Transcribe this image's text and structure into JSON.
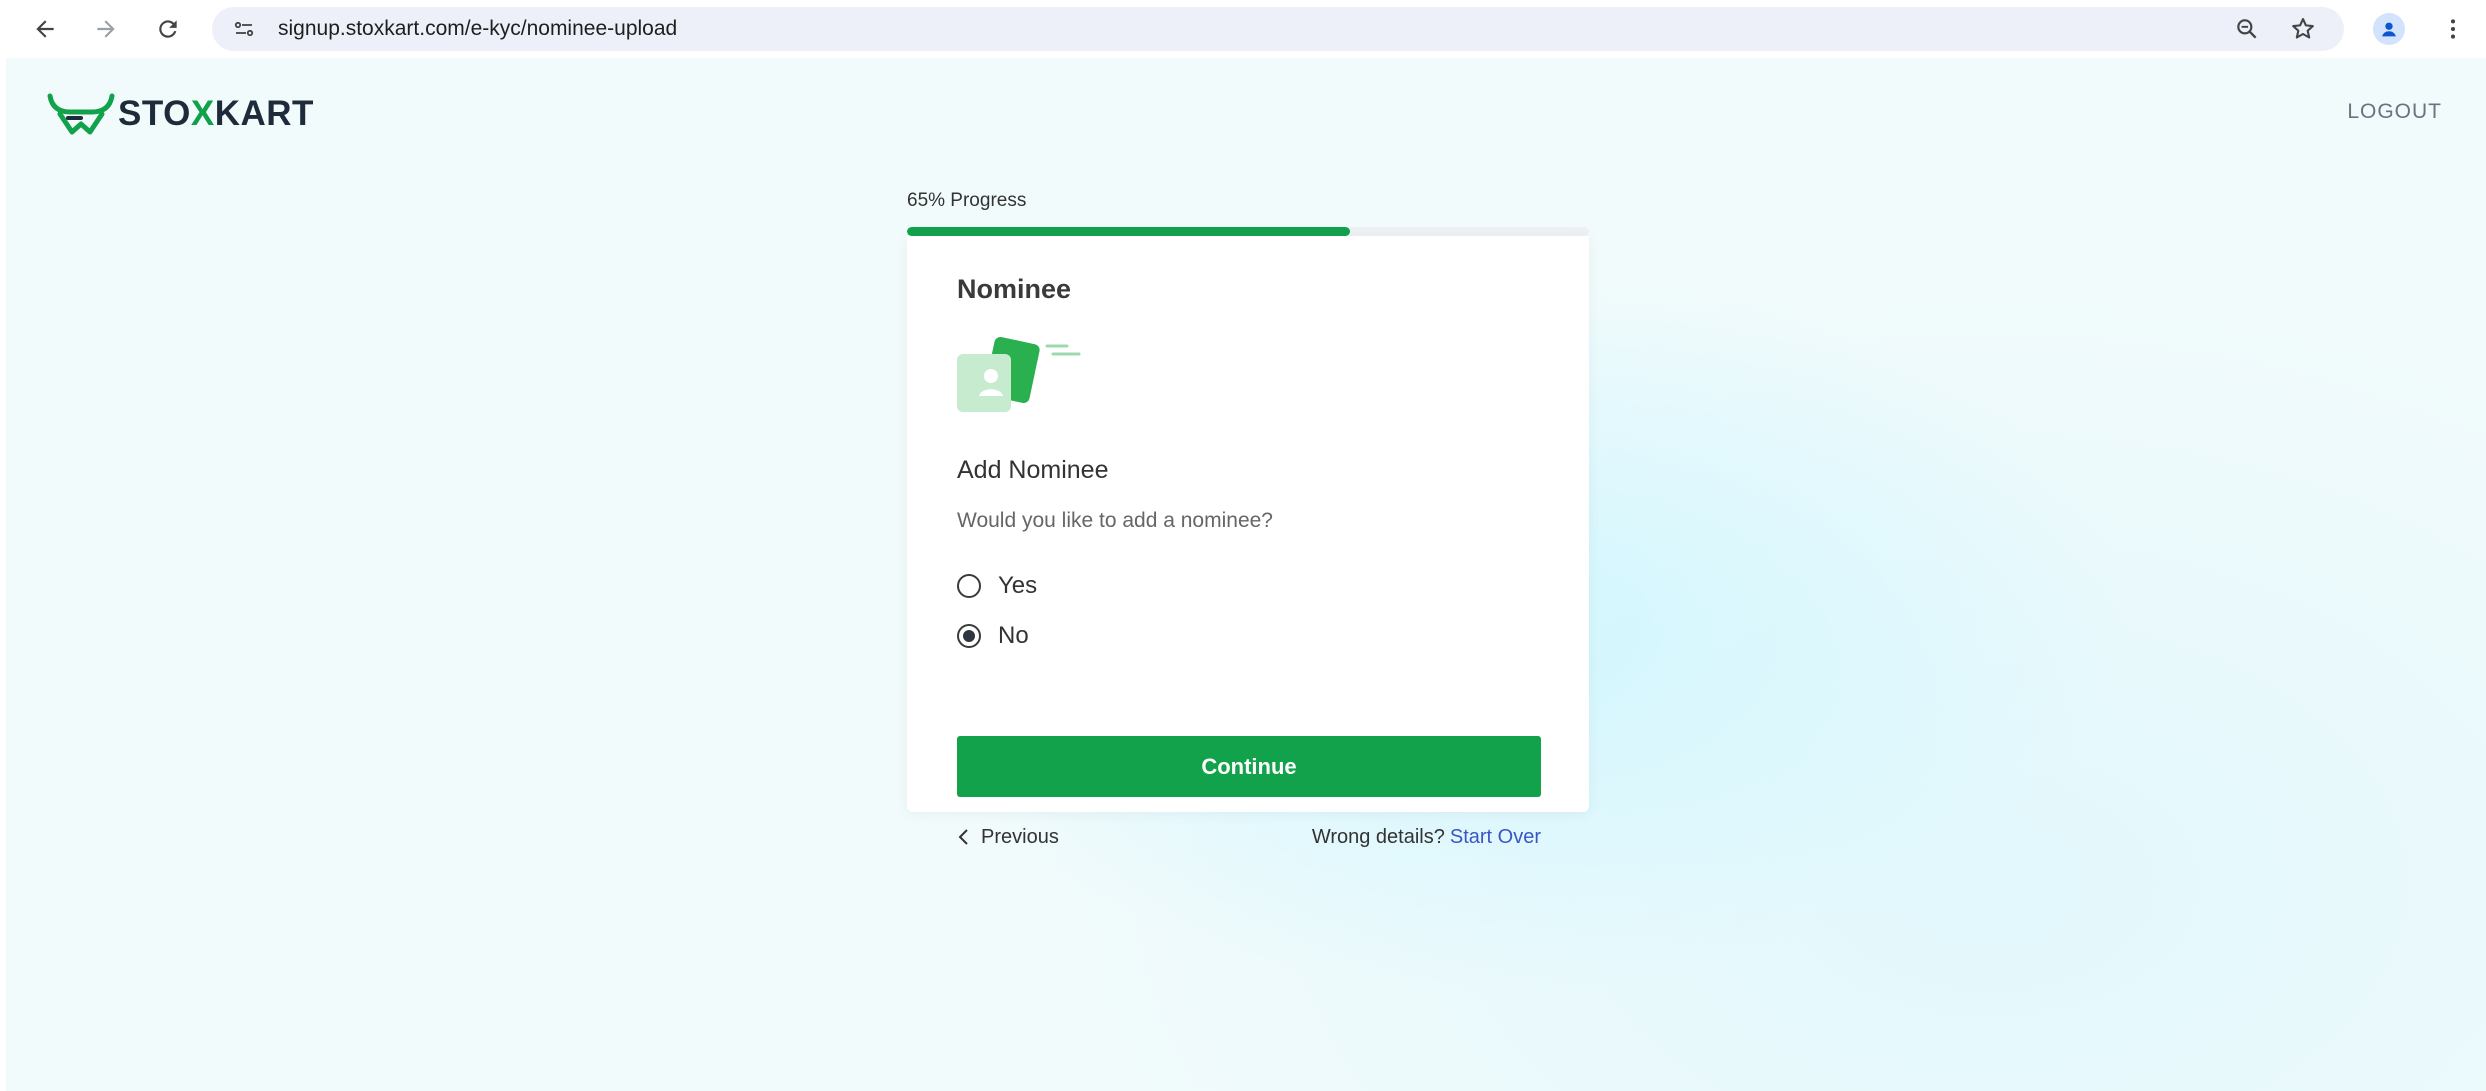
{
  "browser": {
    "url": "signup.stoxkart.com/e-kyc/nominee-upload",
    "icons": [
      "back-icon",
      "forward-icon",
      "reload-icon",
      "site-info-icon",
      "zoom-icon",
      "star-icon",
      "profile-icon",
      "menu-icon"
    ]
  },
  "header": {
    "brand_prefix": "STO",
    "brand_x": "X",
    "brand_suffix": "KART",
    "logout_label": "LOGOUT"
  },
  "progress": {
    "label": "65% Progress",
    "value_percent": 65
  },
  "card": {
    "title": "Nominee",
    "section_title": "Add Nominee",
    "question": "Would you like to add a nominee?",
    "options": [
      {
        "label": "Yes",
        "selected": false
      },
      {
        "label": "No",
        "selected": true
      }
    ],
    "continue_label": "Continue",
    "previous_label": "Previous",
    "wrong_details_text": "Wrong details?",
    "start_over_label": "Start Over"
  },
  "colors": {
    "accent": "#12a24b",
    "link": "#3a56c5",
    "brand_dark": "#1d2b3a"
  }
}
